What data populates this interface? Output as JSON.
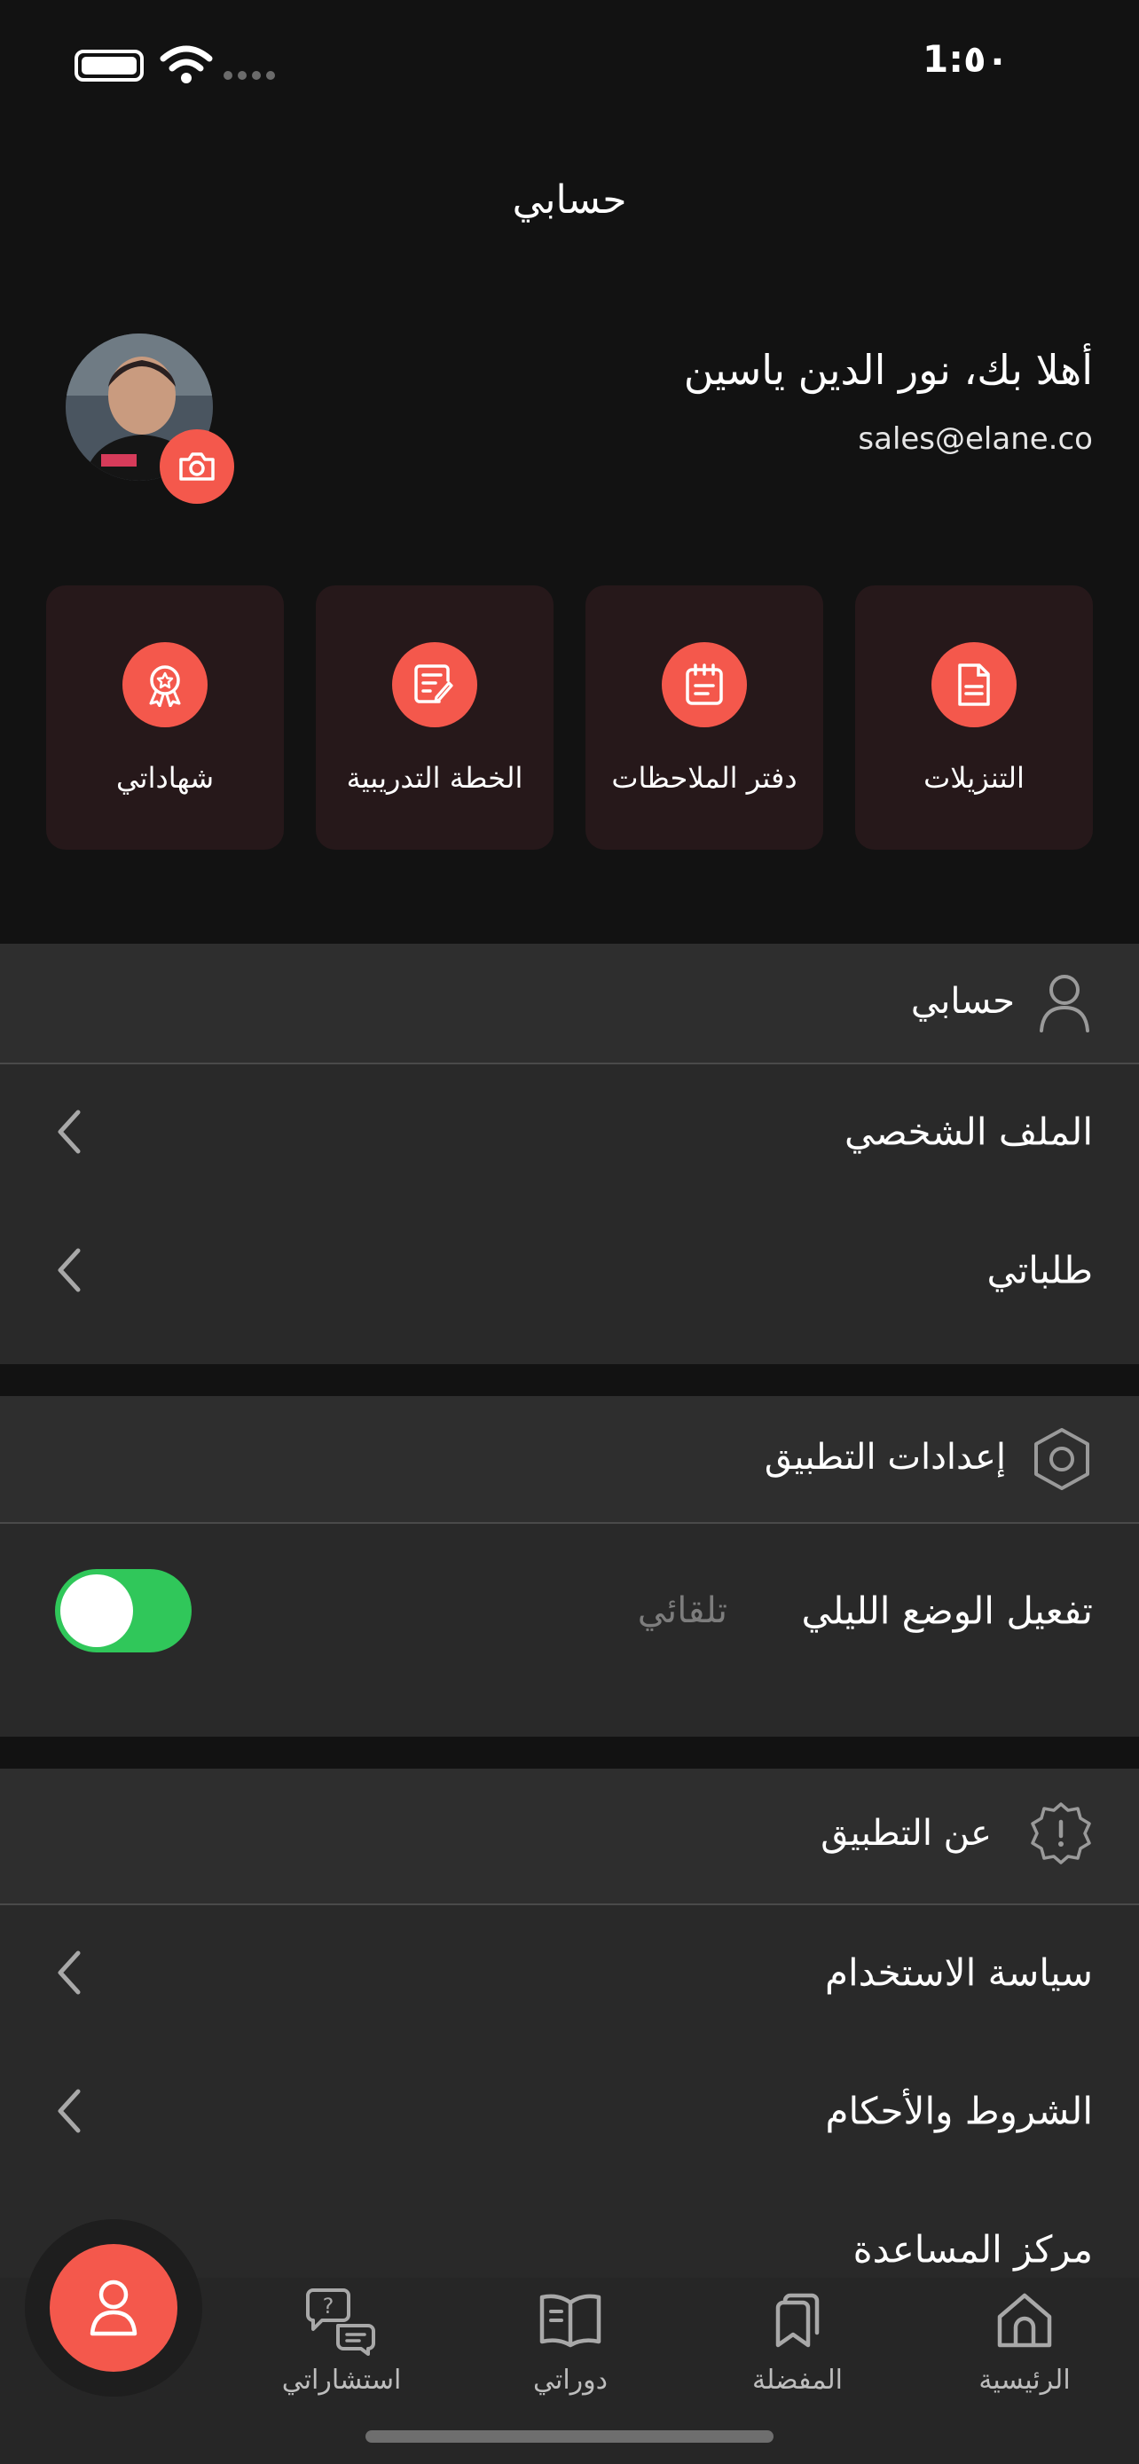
{
  "status_bar": {
    "time": "1:٥٠"
  },
  "header": {
    "title": "حسابي"
  },
  "profile": {
    "greeting": "أهلا بك، نور الدين ياسين",
    "email": "sales@elane.co"
  },
  "quick_actions": [
    {
      "label": "التنزيلات",
      "icon": "document-icon"
    },
    {
      "label": "دفتر الملاحظات",
      "icon": "calendar-notes-icon"
    },
    {
      "label": "الخطة التدريبية",
      "icon": "edit-plan-icon"
    },
    {
      "label": "شهاداتي",
      "icon": "award-icon"
    }
  ],
  "account_section": {
    "title": "حسابي",
    "items": [
      {
        "label": "الملف الشخصي"
      },
      {
        "label": "طلباتي"
      }
    ]
  },
  "settings_section": {
    "title": "إعدادات التطبيق",
    "night_mode": {
      "label": "تفعيل الوضع الليلي",
      "mode": "تلقائي",
      "enabled": true
    }
  },
  "about_section": {
    "title": "عن التطبيق",
    "items": [
      {
        "label": "سياسة الاستخدام"
      },
      {
        "label": "الشروط والأحكام"
      },
      {
        "label": "مركز المساعدة"
      }
    ]
  },
  "bottom_nav": [
    {
      "label": "الرئيسية"
    },
    {
      "label": "المفضلة"
    },
    {
      "label": "دوراتي"
    },
    {
      "label": "استشاراتي"
    }
  ],
  "colors": {
    "accent": "#f4584c",
    "toggle_on": "#30c75a",
    "background": "#121212",
    "card": "#26181a"
  }
}
